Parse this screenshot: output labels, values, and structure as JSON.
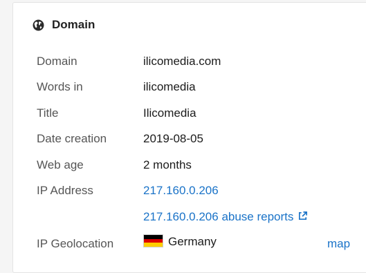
{
  "section": {
    "title": "Domain",
    "icon": "globe-icon"
  },
  "rows": [
    {
      "label": "Domain",
      "value": "ilicomedia.com"
    },
    {
      "label": "Words in",
      "value": "ilicomedia"
    },
    {
      "label": "Title",
      "value": "Ilicomedia"
    },
    {
      "label": "Date creation",
      "value": "2019-08-05"
    },
    {
      "label": "Web age",
      "value": "2 months"
    },
    {
      "label": "IP Address",
      "value": "217.160.0.206"
    }
  ],
  "abuse_link": {
    "text": "217.160.0.206 abuse reports",
    "icon": "external-link-icon"
  },
  "geolocation": {
    "label": "IP Geolocation",
    "country": "Germany",
    "flag_icon": "germany-flag-icon",
    "flag_colors": [
      "#000000",
      "#dd0000",
      "#ffce00"
    ],
    "map_label": "map"
  },
  "colors": {
    "link": "#1a73c8",
    "label": "#555555",
    "text": "#1b1b1b"
  }
}
